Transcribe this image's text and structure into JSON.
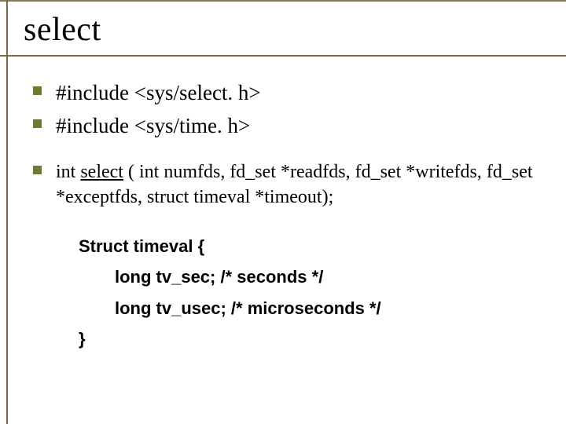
{
  "title": "select",
  "bullets_main": [
    "#include <sys/select. h>",
    "#include <sys/time. h>"
  ],
  "bullet_func_prefix": "int ",
  "bullet_func_name": "select",
  "bullet_func_sig": " ( int numfds, fd_set *readfds, fd_set *writefds, fd_set *exceptfds, struct timeval *timeout);",
  "code_open": "Struct timeval {",
  "code_line1": "long tv_sec;  /* seconds */",
  "code_line2": "long tv_usec; /* microseconds */",
  "code_close": "}"
}
